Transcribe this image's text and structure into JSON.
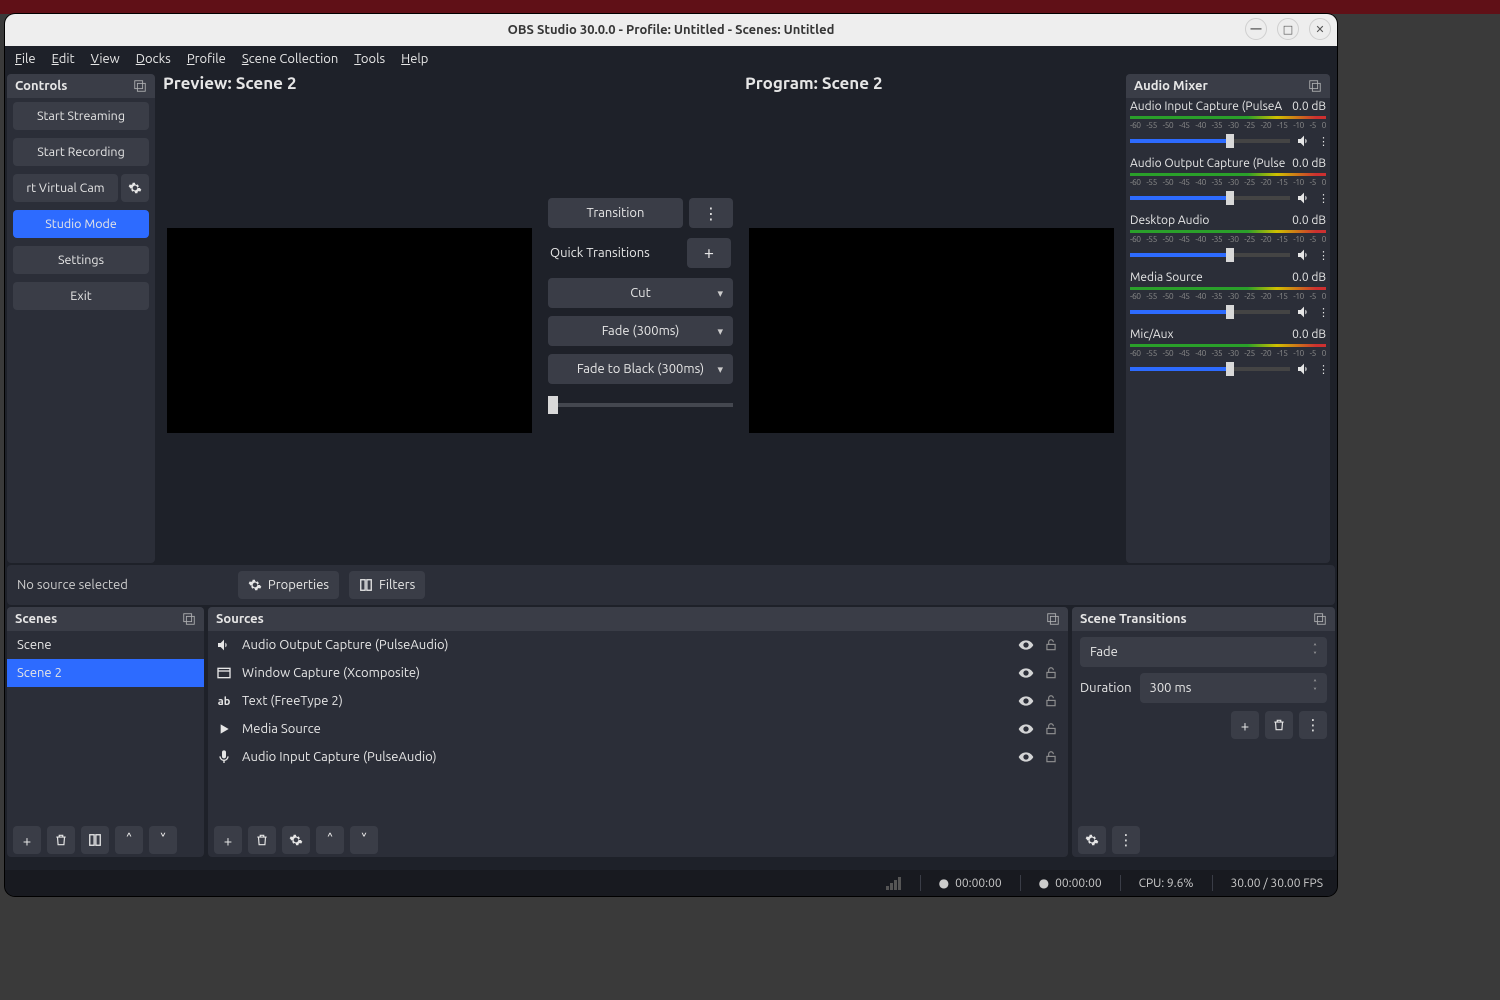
{
  "title": "OBS Studio 30.0.0 - Profile: Untitled - Scenes: Untitled",
  "menu": [
    "File",
    "Edit",
    "View",
    "Docks",
    "Profile",
    "Scene Collection",
    "Tools",
    "Help"
  ],
  "controls": {
    "title": "Controls",
    "start_streaming": "Start Streaming",
    "start_recording": "Start Recording",
    "virtual_cam": "rt Virtual Cam",
    "studio_mode": "Studio Mode",
    "settings": "Settings",
    "exit": "Exit"
  },
  "preview_label": "Preview: Scene 2",
  "program_label": "Program: Scene 2",
  "transition": {
    "button": "Transition",
    "quick_label": "Quick Transitions",
    "qt": [
      "Cut",
      "Fade (300ms)",
      "Fade to Black (300ms)"
    ]
  },
  "mixer": {
    "title": "Audio Mixer",
    "ticks": [
      "-60",
      "-55",
      "-50",
      "-45",
      "-40",
      "-35",
      "-30",
      "-25",
      "-20",
      "-15",
      "-10",
      "-5",
      "0"
    ],
    "items": [
      {
        "name": "Audio Input Capture (PulseA",
        "db": "0.0 dB"
      },
      {
        "name": "Audio Output Capture (Pulse",
        "db": "0.0 dB"
      },
      {
        "name": "Desktop Audio",
        "db": "0.0 dB"
      },
      {
        "name": "Media Source",
        "db": "0.0 dB"
      },
      {
        "name": "Mic/Aux",
        "db": "0.0 dB"
      }
    ]
  },
  "midbar": {
    "no_source": "No source selected",
    "properties": "Properties",
    "filters": "Filters"
  },
  "scenes": {
    "title": "Scenes",
    "items": [
      "Scene",
      "Scene 2"
    ],
    "selected": 1
  },
  "sources": {
    "title": "Sources",
    "items": [
      {
        "icon": "speaker",
        "name": "Audio Output Capture (PulseAudio)"
      },
      {
        "icon": "window",
        "name": "Window Capture (Xcomposite)"
      },
      {
        "icon": "text",
        "name": "Text (FreeType 2)"
      },
      {
        "icon": "play",
        "name": "Media Source"
      },
      {
        "icon": "mic",
        "name": "Audio Input Capture (PulseAudio)"
      }
    ]
  },
  "scene_transitions": {
    "title": "Scene Transitions",
    "selected": "Fade",
    "duration_label": "Duration",
    "duration_value": "300 ms"
  },
  "status": {
    "time1": "00:00:00",
    "time2": "00:00:00",
    "cpu": "CPU: 9.6%",
    "fps": "30.00 / 30.00 FPS"
  }
}
